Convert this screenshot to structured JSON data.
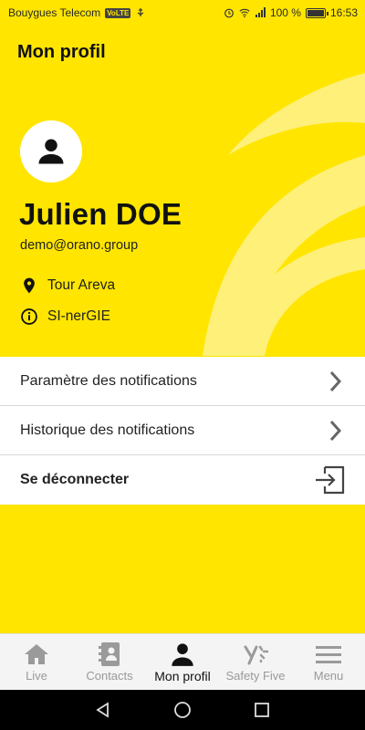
{
  "status_bar": {
    "carrier": "Bouygues Telecom",
    "volte": "VoLTE",
    "battery": "100 %",
    "battery_level": 1.0,
    "time": "16:53"
  },
  "header": {
    "title": "Mon profil"
  },
  "profile": {
    "name": "Julien DOE",
    "email": "demo@orano.group",
    "location": "Tour Areva",
    "department": "SI-nerGIE"
  },
  "menu": {
    "items": [
      {
        "label": "Paramètre des notifications",
        "icon": "chevron-right-icon"
      },
      {
        "label": "Historique des notifications",
        "icon": "chevron-right-icon"
      },
      {
        "label": "Se déconnecter",
        "icon": "logout-icon"
      }
    ]
  },
  "bottom_nav": {
    "items": [
      {
        "label": "Live",
        "icon": "home-icon"
      },
      {
        "label": "Contacts",
        "icon": "contacts-icon"
      },
      {
        "label": "Mon profil",
        "icon": "person-icon",
        "active": true
      },
      {
        "label": "Safety Five",
        "icon": "safety-five-icon"
      },
      {
        "label": "Menu",
        "icon": "hamburger-icon"
      }
    ]
  },
  "colors": {
    "accent": "#FFE500",
    "text": "#111111",
    "inactive": "#999999"
  }
}
